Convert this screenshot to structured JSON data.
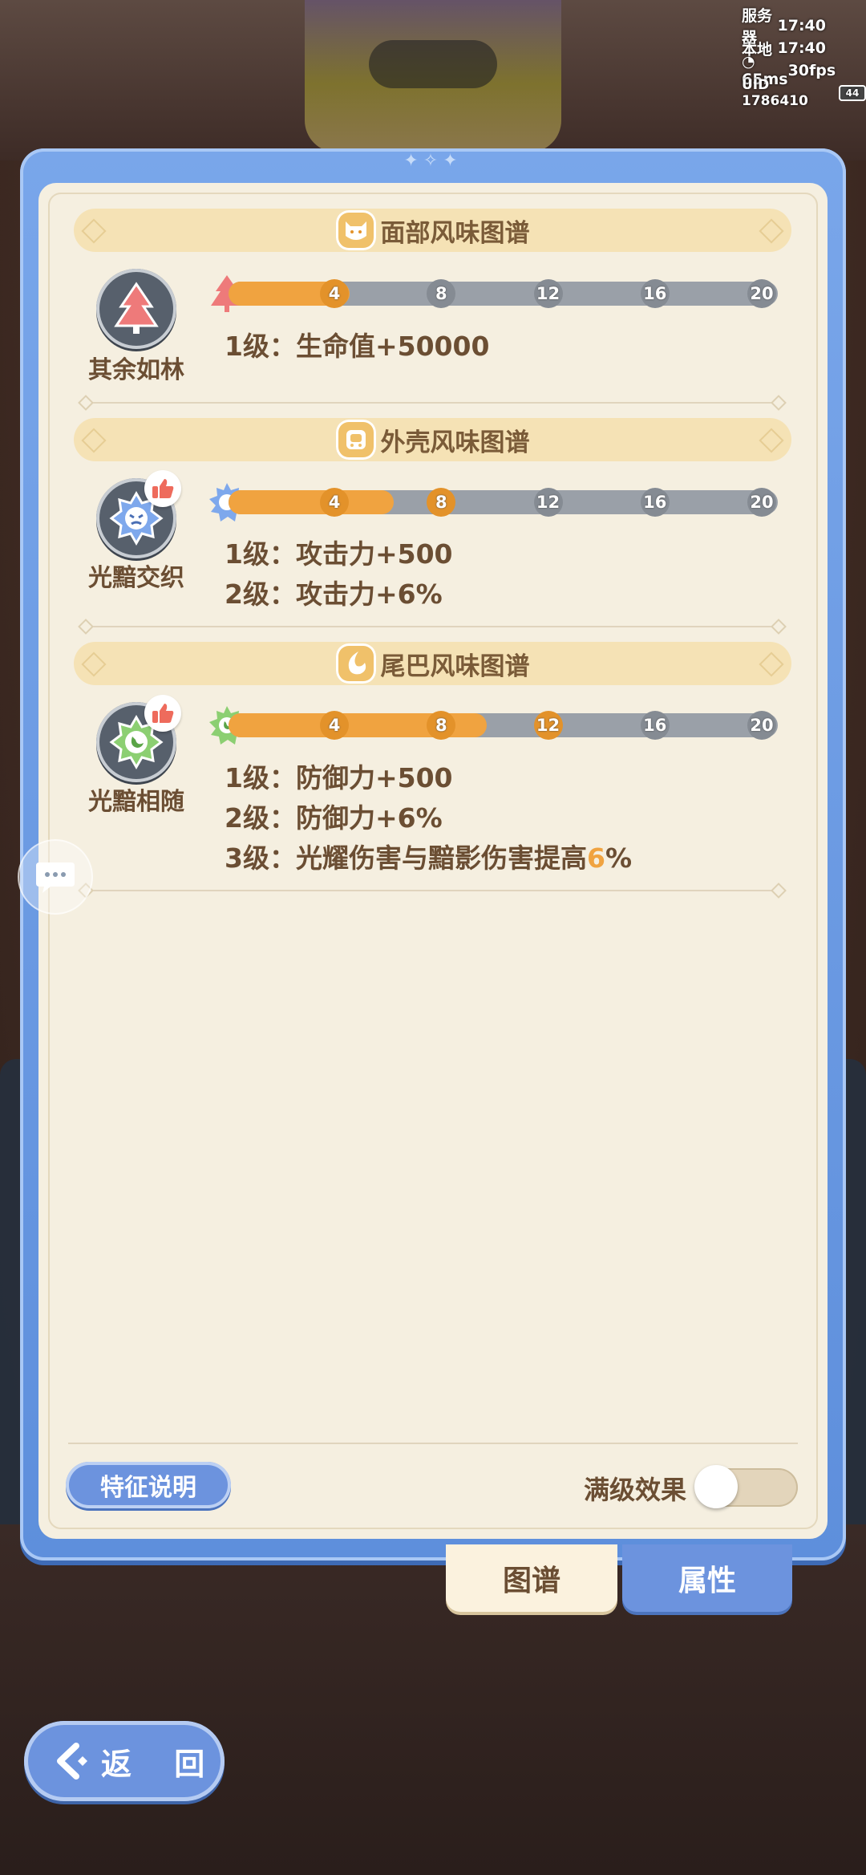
{
  "status": {
    "server_label": "服务器",
    "server_time": "17:40",
    "local_label": "本地",
    "local_time": "17:40",
    "ping": "65ms",
    "fps": "30fps",
    "uid": "UID 1786410",
    "battery": "44"
  },
  "sections": [
    {
      "title": "面部风味图谱",
      "medal_name": "其余如林",
      "medal_icon": "pine-tree-icon",
      "progress_fraction": 0.22,
      "nodes": [
        "4",
        "8",
        "12",
        "16",
        "20"
      ],
      "nodes_reached": 1,
      "effects": [
        {
          "level": "1级：",
          "text": "生命值+50000"
        }
      ],
      "liked": false
    },
    {
      "title": "外壳风味图谱",
      "medal_name": "光黯交织",
      "medal_icon": "angry-sun-icon",
      "progress_fraction": 0.3,
      "nodes": [
        "4",
        "8",
        "12",
        "16",
        "20"
      ],
      "nodes_reached": 2,
      "effects": [
        {
          "level": "1级：",
          "text": "攻击力+500"
        },
        {
          "level": "2级：",
          "text": "攻击力+6%"
        }
      ],
      "liked": true
    },
    {
      "title": "尾巴风味图谱",
      "medal_name": "光黯相随",
      "medal_icon": "moon-star-icon",
      "progress_fraction": 0.47,
      "nodes": [
        "4",
        "8",
        "12",
        "16",
        "20"
      ],
      "nodes_reached": 3,
      "effects": [
        {
          "level": "1级：",
          "text": "防御力+500"
        },
        {
          "level": "2级：",
          "text": "防御力+6%"
        },
        {
          "level": "3级：",
          "text": "光耀伤害与黯影伤害提高",
          "highlight": "6",
          "suffix": "%"
        }
      ],
      "liked": true
    }
  ],
  "footer": {
    "desc_button": "特征说明",
    "max_effect_label": "满级效果",
    "max_effect_on": false
  },
  "tabs": {
    "atlas": "图谱",
    "attributes": "属性",
    "active": "atlas"
  },
  "background": {
    "slot1": "1级",
    "slot2": "2级"
  },
  "back_button": "返 回",
  "colors": {
    "accent_blue": "#6c93de",
    "progress_orange": "#f0a340",
    "panel_cream": "#f5efe0",
    "text_brown": "#6b4e33"
  }
}
